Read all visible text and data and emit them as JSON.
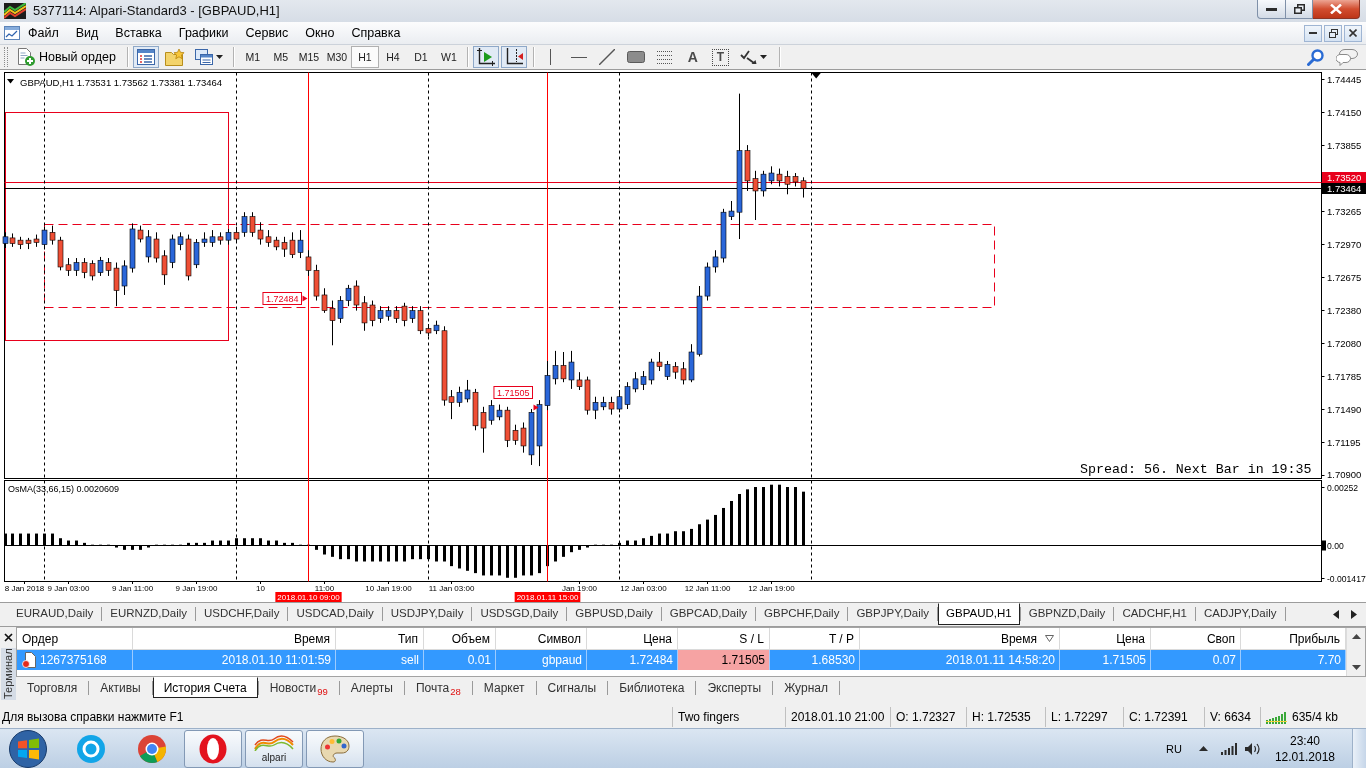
{
  "window": {
    "title": "5377114: Alpari-Standard3 - [GBPAUD,H1]"
  },
  "menu": [
    "Файл",
    "Вид",
    "Вставка",
    "Графики",
    "Сервис",
    "Окно",
    "Справка"
  ],
  "toolbar": {
    "new_order": "Новый ордер",
    "buttons": [
      {
        "kind": "market_watch",
        "pressed": true
      },
      {
        "kind": "navigator",
        "pressed": false
      },
      {
        "kind": "profiles",
        "pressed": false
      }
    ],
    "timeframes": [
      {
        "label": "M1",
        "selected": false
      },
      {
        "label": "M5",
        "selected": false
      },
      {
        "label": "M15",
        "selected": false
      },
      {
        "label": "M30",
        "selected": false
      },
      {
        "label": "H1",
        "selected": true
      },
      {
        "label": "H4",
        "selected": false
      },
      {
        "label": "D1",
        "selected": false
      },
      {
        "label": "W1",
        "selected": false
      }
    ],
    "chart_buttons": [
      {
        "kind": "autoscroll",
        "pressed": true
      },
      {
        "kind": "chart_shift",
        "pressed": true
      }
    ],
    "tools": [
      {
        "kind": "vertical_line"
      },
      {
        "kind": "horizontal_line"
      },
      {
        "kind": "trendline"
      },
      {
        "kind": "rectangle"
      },
      {
        "kind": "fibonacci"
      },
      {
        "kind": "text",
        "glyph": "A"
      },
      {
        "kind": "text_label",
        "glyph": "T"
      },
      {
        "kind": "arrows"
      }
    ]
  },
  "chart": {
    "chart_data": [
      {
        "type": "candlestick",
        "title": "GBPAUD,H1 1.73531 1.73562 1.73381 1.73464",
        "x": [
          "2018-01-08T19:00",
          "2018-01-08T20:00",
          "2018-01-08T21:00",
          "2018-01-08T22:00",
          "2018-01-08T23:00",
          "2018-01-09T00:00",
          "2018-01-09T01:00",
          "2018-01-09T02:00",
          "2018-01-09T03:00",
          "2018-01-09T04:00",
          "2018-01-09T05:00",
          "2018-01-09T06:00",
          "2018-01-09T07:00",
          "2018-01-09T08:00",
          "2018-01-09T09:00",
          "2018-01-09T10:00",
          "2018-01-09T11:00",
          "2018-01-09T12:00",
          "2018-01-09T13:00",
          "2018-01-09T14:00",
          "2018-01-09T15:00",
          "2018-01-09T16:00",
          "2018-01-09T17:00",
          "2018-01-09T18:00",
          "2018-01-09T19:00",
          "2018-01-09T20:00",
          "2018-01-09T21:00",
          "2018-01-09T22:00",
          "2018-01-09T23:00",
          "2018-01-10T00:00",
          "2018-01-10T01:00",
          "2018-01-10T02:00",
          "2018-01-10T03:00",
          "2018-01-10T04:00",
          "2018-01-10T05:00",
          "2018-01-10T06:00",
          "2018-01-10T07:00",
          "2018-01-10T08:00",
          "2018-01-10T09:00",
          "2018-01-10T10:00",
          "2018-01-10T11:00",
          "2018-01-10T12:00",
          "2018-01-10T13:00",
          "2018-01-10T14:00",
          "2018-01-10T15:00",
          "2018-01-10T16:00",
          "2018-01-10T17:00",
          "2018-01-10T18:00",
          "2018-01-10T19:00",
          "2018-01-10T20:00",
          "2018-01-10T21:00",
          "2018-01-10T22:00",
          "2018-01-10T23:00",
          "2018-01-11T00:00",
          "2018-01-11T01:00",
          "2018-01-11T02:00",
          "2018-01-11T03:00",
          "2018-01-11T04:00",
          "2018-01-11T05:00",
          "2018-01-11T06:00",
          "2018-01-11T07:00",
          "2018-01-11T08:00",
          "2018-01-11T09:00",
          "2018-01-11T10:00",
          "2018-01-11T11:00",
          "2018-01-11T12:00",
          "2018-01-11T13:00",
          "2018-01-11T14:00",
          "2018-01-11T15:00",
          "2018-01-11T16:00",
          "2018-01-11T17:00",
          "2018-01-11T18:00",
          "2018-01-11T19:00",
          "2018-01-11T20:00",
          "2018-01-11T21:00",
          "2018-01-11T22:00",
          "2018-01-11T23:00",
          "2018-01-12T00:00",
          "2018-01-12T01:00",
          "2018-01-12T02:00",
          "2018-01-12T03:00",
          "2018-01-12T04:00",
          "2018-01-12T05:00",
          "2018-01-12T06:00",
          "2018-01-12T07:00",
          "2018-01-12T08:00",
          "2018-01-12T09:00",
          "2018-01-12T10:00",
          "2018-01-12T11:00",
          "2018-01-12T12:00",
          "2018-01-12T13:00",
          "2018-01-12T14:00",
          "2018-01-12T15:00",
          "2018-01-12T16:00",
          "2018-01-12T17:00",
          "2018-01-12T18:00",
          "2018-01-12T19:00",
          "2018-01-12T20:00",
          "2018-01-12T21:00",
          "2018-01-12T22:00",
          "2018-01-12T23:00"
        ],
        "ohlc": [
          [
            1.7297,
            1.7307,
            1.7293,
            1.7303
          ],
          [
            1.7302,
            1.7306,
            1.7294,
            1.7297
          ],
          [
            1.73,
            1.7303,
            1.7292,
            1.7296
          ],
          [
            1.73,
            1.7302,
            1.7292,
            1.7297
          ],
          [
            1.7301,
            1.7305,
            1.7294,
            1.7298
          ],
          [
            1.7296,
            1.7312,
            1.7292,
            1.7309
          ],
          [
            1.7307,
            1.7313,
            1.7296,
            1.73
          ],
          [
            1.73,
            1.7303,
            1.7273,
            1.7276
          ],
          [
            1.7278,
            1.7284,
            1.7268,
            1.7273
          ],
          [
            1.7273,
            1.7284,
            1.7268,
            1.728
          ],
          [
            1.728,
            1.7284,
            1.7266,
            1.7271
          ],
          [
            1.7279,
            1.7282,
            1.7264,
            1.7268
          ],
          [
            1.7271,
            1.7285,
            1.7268,
            1.7282
          ],
          [
            1.728,
            1.7284,
            1.7268,
            1.7273
          ],
          [
            1.7275,
            1.728,
            1.7241,
            1.7255
          ],
          [
            1.7259,
            1.7282,
            1.7251,
            1.7277
          ],
          [
            1.7275,
            1.7315,
            1.7271,
            1.731
          ],
          [
            1.7309,
            1.7313,
            1.7298,
            1.7301
          ],
          [
            1.7285,
            1.7309,
            1.728,
            1.7303
          ],
          [
            1.7301,
            1.7307,
            1.728,
            1.7284
          ],
          [
            1.7286,
            1.7291,
            1.726,
            1.7269
          ],
          [
            1.728,
            1.7305,
            1.7275,
            1.7301
          ],
          [
            1.7296,
            1.7307,
            1.7291,
            1.7303
          ],
          [
            1.7301,
            1.7305,
            1.7264,
            1.7268
          ],
          [
            1.7278,
            1.7301,
            1.7275,
            1.7298
          ],
          [
            1.7298,
            1.7307,
            1.7294,
            1.7301
          ],
          [
            1.7298,
            1.7309,
            1.7294,
            1.7303
          ],
          [
            1.7303,
            1.7307,
            1.7296,
            1.73
          ],
          [
            1.73,
            1.731,
            1.7296,
            1.7307
          ],
          [
            1.7307,
            1.7312,
            1.7298,
            1.7301
          ],
          [
            1.7307,
            1.7325,
            1.7303,
            1.7321
          ],
          [
            1.7321,
            1.7325,
            1.7303,
            1.7307
          ],
          [
            1.7309,
            1.7316,
            1.7296,
            1.7301
          ],
          [
            1.7303,
            1.7309,
            1.7294,
            1.7298
          ],
          [
            1.73,
            1.7303,
            1.7291,
            1.7294
          ],
          [
            1.7298,
            1.7303,
            1.7285,
            1.7292
          ],
          [
            1.73,
            1.7307,
            1.7284,
            1.7287
          ],
          [
            1.7289,
            1.7309,
            1.7284,
            1.73
          ],
          [
            1.7285,
            1.7291,
            1.7268,
            1.7273
          ],
          [
            1.7273,
            1.7278,
            1.7246,
            1.725
          ],
          [
            1.7251,
            1.7257,
            1.7235,
            1.7237
          ],
          [
            1.7239,
            1.7246,
            1.7206,
            1.7228
          ],
          [
            1.723,
            1.725,
            1.7226,
            1.7246
          ],
          [
            1.7246,
            1.726,
            1.7241,
            1.7257
          ],
          [
            1.7259,
            1.7264,
            1.7237,
            1.7242
          ],
          [
            1.7244,
            1.725,
            1.7219,
            1.7226
          ],
          [
            1.7242,
            1.7246,
            1.7223,
            1.7228
          ],
          [
            1.723,
            1.7241,
            1.7226,
            1.7237
          ],
          [
            1.7232,
            1.7241,
            1.7228,
            1.7237
          ],
          [
            1.7237,
            1.7241,
            1.7226,
            1.723
          ],
          [
            1.7241,
            1.7244,
            1.7223,
            1.7228
          ],
          [
            1.723,
            1.7241,
            1.7226,
            1.7237
          ],
          [
            1.7237,
            1.7241,
            1.7216,
            1.7219
          ],
          [
            1.7221,
            1.7225,
            1.7214,
            1.7217
          ],
          [
            1.7219,
            1.7228,
            1.7216,
            1.7224
          ],
          [
            1.7219,
            1.7223,
            1.7152,
            1.7157
          ],
          [
            1.716,
            1.7166,
            1.714,
            1.7155
          ],
          [
            1.7155,
            1.7169,
            1.7151,
            1.7164
          ],
          [
            1.7158,
            1.7175,
            1.7155,
            1.7166
          ],
          [
            1.7164,
            1.7167,
            1.713,
            1.7134
          ],
          [
            1.7146,
            1.7151,
            1.711,
            1.7132
          ],
          [
            1.7139,
            1.7157,
            1.7135,
            1.7152
          ],
          [
            1.7142,
            1.7153,
            1.7139,
            1.7148
          ],
          [
            1.7148,
            1.7151,
            1.7115,
            1.7121
          ],
          [
            1.713,
            1.7135,
            1.7117,
            1.7121
          ],
          [
            1.7132,
            1.7137,
            1.711,
            1.7116
          ],
          [
            1.7108,
            1.7149,
            1.7099,
            1.7146
          ],
          [
            1.7116,
            1.7157,
            1.7098,
            1.7153
          ],
          [
            1.7152,
            1.7192,
            1.7148,
            1.7179
          ],
          [
            1.7176,
            1.7201,
            1.7171,
            1.7188
          ],
          [
            1.7188,
            1.72,
            1.7173,
            1.7176
          ],
          [
            1.7175,
            1.7201,
            1.7167,
            1.7191
          ],
          [
            1.7175,
            1.7182,
            1.7166,
            1.7169
          ],
          [
            1.7175,
            1.7178,
            1.7144,
            1.7148
          ],
          [
            1.7148,
            1.716,
            1.714,
            1.7155
          ],
          [
            1.7151,
            1.716,
            1.7148,
            1.7155
          ],
          [
            1.7155,
            1.716,
            1.7144,
            1.7149
          ],
          [
            1.7149,
            1.7166,
            1.7146,
            1.716
          ],
          [
            1.7153,
            1.7173,
            1.7149,
            1.7169
          ],
          [
            1.7167,
            1.7182,
            1.7164,
            1.7176
          ],
          [
            1.7171,
            1.7183,
            1.7166,
            1.7178
          ],
          [
            1.7175,
            1.7194,
            1.7171,
            1.7191
          ],
          [
            1.7191,
            1.72,
            1.7183,
            1.7187
          ],
          [
            1.7178,
            1.7192,
            1.7175,
            1.7189
          ],
          [
            1.7187,
            1.7191,
            1.7176,
            1.7182
          ],
          [
            1.7185,
            1.7191,
            1.7171,
            1.7175
          ],
          [
            1.7175,
            1.7207,
            1.7173,
            1.72
          ],
          [
            1.7198,
            1.7259,
            1.7196,
            1.725
          ],
          [
            1.725,
            1.728,
            1.7246,
            1.7276
          ],
          [
            1.7276,
            1.7291,
            1.7271,
            1.7285
          ],
          [
            1.7284,
            1.7328,
            1.728,
            1.7325
          ],
          [
            1.7321,
            1.7335,
            1.7318,
            1.7326
          ],
          [
            1.7325,
            1.7431,
            1.7301,
            1.738
          ],
          [
            1.738,
            1.7385,
            1.7344,
            1.7353
          ],
          [
            1.7355,
            1.7362,
            1.7318,
            1.7344
          ],
          [
            1.7344,
            1.7362,
            1.7339,
            1.7359
          ],
          [
            1.7353,
            1.7366,
            1.735,
            1.736
          ],
          [
            1.7359,
            1.7364,
            1.7348,
            1.7353
          ],
          [
            1.7357,
            1.7362,
            1.7341,
            1.735
          ],
          [
            1.7357,
            1.736,
            1.7348,
            1.7352
          ],
          [
            1.73531,
            1.73562,
            1.73381,
            1.73464
          ]
        ],
        "series": [
          {
            "type": "scatter",
            "x": [
              "2018-01-10T09:00",
              "2018-01-11T14:00"
            ],
            "values": [
              1.72484,
              1.71505
            ],
            "color": "#e8001c",
            "data_labels": true
          }
        ],
        "xlim": [
          "2018-01-08T19:00",
          "2018-01-15T16:00"
        ],
        "ylim": [
          1.70869,
          1.74499
        ],
        "yticks": [
          {
            "value": 1.74445,
            "label": "1.74445"
          },
          {
            "value": 1.7415,
            "label": "1.74150"
          },
          {
            "value": 1.73855,
            "label": "1.73855"
          },
          {
            "value": 1.73265,
            "label": "1.73265"
          },
          {
            "value": 1.7297,
            "label": "1.72970"
          },
          {
            "value": 1.72675,
            "label": "1.72675"
          },
          {
            "value": 1.7238,
            "label": "1.72380"
          },
          {
            "value": 1.7208,
            "label": "1.72080"
          },
          {
            "value": 1.71785,
            "label": "1.71785"
          },
          {
            "value": 1.7149,
            "label": "1.71490"
          },
          {
            "value": 1.71195,
            "label": "1.71195"
          },
          {
            "value": 1.709,
            "label": "1.70900"
          }
        ],
        "tick_labels": "y",
        "ref_lines": [
          {
            "axis": "y",
            "value": 1.7352,
            "label": "1.73520",
            "color": "#e8001c"
          },
          {
            "axis": "y",
            "value": 1.73464,
            "label": "1.73464",
            "color": "#000000"
          },
          {
            "axis": "x",
            "value": "2018-01-10T09:00",
            "label": "2018.01.10 09:00",
            "color": "#ff0000"
          },
          {
            "axis": "x",
            "value": "2018-01-11T15:00",
            "label": "2018.01.11 15:00",
            "color": "#ff0000"
          },
          {
            "axis": "x",
            "value": "2018-01-09T00:00",
            "color": "#000000",
            "line_style": "dashed"
          },
          {
            "axis": "x",
            "value": "2018-01-10T00:00",
            "color": "#000000",
            "line_style": "dashed"
          },
          {
            "axis": "x",
            "value": "2018-01-11T00:00",
            "color": "#000000",
            "line_style": "dashed"
          },
          {
            "axis": "x",
            "value": "2018-01-12T00:00",
            "color": "#000000",
            "line_style": "dashed"
          },
          {
            "axis": "x",
            "value": "2018-01-13T00:00",
            "color": "#000000",
            "line_style": "dashed"
          }
        ],
        "annotations": [
          "Spread: 56. Next Bar in 19:35"
        ]
      },
      {
        "type": "bar",
        "title": "OsMA(33,66,15) 0.0020609",
        "x": [
          "2018-01-08T19:00",
          "2018-01-08T20:00",
          "2018-01-08T21:00",
          "2018-01-08T22:00",
          "2018-01-08T23:00",
          "2018-01-09T00:00",
          "2018-01-09T01:00",
          "2018-01-09T02:00",
          "2018-01-09T03:00",
          "2018-01-09T04:00",
          "2018-01-09T05:00",
          "2018-01-09T06:00",
          "2018-01-09T07:00",
          "2018-01-09T08:00",
          "2018-01-09T09:00",
          "2018-01-09T10:00",
          "2018-01-09T11:00",
          "2018-01-09T12:00",
          "2018-01-09T13:00",
          "2018-01-09T14:00",
          "2018-01-09T15:00",
          "2018-01-09T16:00",
          "2018-01-09T17:00",
          "2018-01-09T18:00",
          "2018-01-09T19:00",
          "2018-01-09T20:00",
          "2018-01-09T21:00",
          "2018-01-09T22:00",
          "2018-01-09T23:00",
          "2018-01-10T00:00",
          "2018-01-10T01:00",
          "2018-01-10T02:00",
          "2018-01-10T03:00",
          "2018-01-10T04:00",
          "2018-01-10T05:00",
          "2018-01-10T06:00",
          "2018-01-10T07:00",
          "2018-01-10T08:00",
          "2018-01-10T09:00",
          "2018-01-10T10:00",
          "2018-01-10T11:00",
          "2018-01-10T12:00",
          "2018-01-10T13:00",
          "2018-01-10T14:00",
          "2018-01-10T15:00",
          "2018-01-10T16:00",
          "2018-01-10T17:00",
          "2018-01-10T18:00",
          "2018-01-10T19:00",
          "2018-01-10T20:00",
          "2018-01-10T21:00",
          "2018-01-10T22:00",
          "2018-01-10T23:00",
          "2018-01-11T00:00",
          "2018-01-11T01:00",
          "2018-01-11T02:00",
          "2018-01-11T03:00",
          "2018-01-11T04:00",
          "2018-01-11T05:00",
          "2018-01-11T06:00",
          "2018-01-11T07:00",
          "2018-01-11T08:00",
          "2018-01-11T09:00",
          "2018-01-11T10:00",
          "2018-01-11T11:00",
          "2018-01-11T12:00",
          "2018-01-11T13:00",
          "2018-01-11T14:00",
          "2018-01-11T15:00",
          "2018-01-11T16:00",
          "2018-01-11T17:00",
          "2018-01-11T18:00",
          "2018-01-11T19:00",
          "2018-01-11T20:00",
          "2018-01-11T21:00",
          "2018-01-11T22:00",
          "2018-01-11T23:00",
          "2018-01-12T00:00",
          "2018-01-12T01:00",
          "2018-01-12T02:00",
          "2018-01-12T03:00",
          "2018-01-12T04:00",
          "2018-01-12T05:00",
          "2018-01-12T06:00",
          "2018-01-12T07:00",
          "2018-01-12T08:00",
          "2018-01-12T09:00",
          "2018-01-12T10:00",
          "2018-01-12T11:00",
          "2018-01-12T12:00",
          "2018-01-12T13:00",
          "2018-01-12T14:00",
          "2018-01-12T15:00",
          "2018-01-12T16:00",
          "2018-01-12T17:00",
          "2018-01-12T18:00",
          "2018-01-12T19:00",
          "2018-01-12T20:00",
          "2018-01-12T21:00",
          "2018-01-12T22:00",
          "2018-01-12T23:00"
        ],
        "values": [
          0.0005,
          0.0005,
          0.0005,
          0.0005,
          0.0005,
          0.0005,
          0.0005,
          0.0003,
          0.0002,
          0.0002,
          0.0001,
          0,
          0,
          0,
          -0.0001,
          -0.0002,
          -0.0002,
          -0.0002,
          -0.0001,
          0,
          0,
          0,
          0,
          0.0001,
          0.0001,
          0.0001,
          0.0002,
          0.0002,
          0.0002,
          0.0003,
          0.0003,
          0.0003,
          0.0003,
          0.0002,
          0.0002,
          0.0001,
          0.0001,
          0,
          0,
          -0.0002,
          -0.0004,
          -0.0005,
          -0.0006,
          -0.0006,
          -0.0007,
          -0.0007,
          -0.0007,
          -0.0007,
          -0.0007,
          -0.0007,
          -0.0007,
          -0.0006,
          -0.0006,
          -0.0006,
          -0.0007,
          -0.0007,
          -0.0009,
          -0.001,
          -0.0011,
          -0.0012,
          -0.0013,
          -0.0013,
          -0.0013,
          -0.0014,
          -0.0014,
          -0.0013,
          -0.0013,
          -0.0012,
          -0.0009,
          -0.0007,
          -0.0005,
          -0.0003,
          -0.0002,
          -0.0001,
          0,
          0,
          0,
          0.0001,
          0.0002,
          0.0002,
          0.0003,
          0.0004,
          0.0005,
          0.0005,
          0.0006,
          0.0006,
          0.0007,
          0.0009,
          0.0011,
          0.0013,
          0.0016,
          0.0019,
          0.0022,
          0.0024,
          0.0025,
          0.0025,
          0.0026,
          0.0026,
          0.0025,
          0.0025,
          0.0023
        ],
        "color": "#000000",
        "xlim": [
          "2018-01-08T19:00",
          "2018-01-15T16:00"
        ],
        "ylim": [
          -0.00156,
          0.00278
        ],
        "yticks": [
          {
            "value": 0.00252,
            "label": "0.00252"
          },
          {
            "value": 0,
            "label": "0.00"
          },
          {
            "value": -0.001417,
            "label": "-0.001417"
          }
        ],
        "xticks": [
          {
            "value": "2018-01-08T21:30",
            "label": "8 Jan 2018"
          },
          {
            "value": "2018-01-09T03:00",
            "label": "9 Jan 03:00"
          },
          {
            "value": "2018-01-09T11:00",
            "label": "9 Jan 11:00"
          },
          {
            "value": "2018-01-09T19:00",
            "label": "9 Jan 19:00"
          },
          {
            "value": "2018-01-10T03:00",
            "label": "10"
          },
          {
            "value": "2018-01-10T11:00",
            "label": "11:00"
          },
          {
            "value": "2018-01-10T19:00",
            "label": "10 Jan 19:00"
          },
          {
            "value": "2018-01-11T03:00",
            "label": "11 Jan 03:00"
          },
          {
            "value": "2018-01-11T19:00",
            "label": "Jan 19:00"
          },
          {
            "value": "2018-01-12T03:00",
            "label": "12 Jan 03:00"
          },
          {
            "value": "2018-01-12T11:00",
            "label": "12 Jan 11:00"
          },
          {
            "value": "2018-01-12T19:00",
            "label": "12 Jan 19:00"
          }
        ],
        "ref_lines": [
          {
            "axis": "y",
            "value": 0,
            "color": "#000000"
          }
        ]
      }
    ]
  },
  "chart_tabs": [
    {
      "label": "EURAUD,Daily",
      "selected": false
    },
    {
      "label": "EURNZD,Daily",
      "selected": false
    },
    {
      "label": "USDCHF,Daily",
      "selected": false
    },
    {
      "label": "USDCAD,Daily",
      "selected": false
    },
    {
      "label": "USDJPY,Daily",
      "selected": false
    },
    {
      "label": "USDSGD,Daily",
      "selected": false
    },
    {
      "label": "GBPUSD,Daily",
      "selected": false
    },
    {
      "label": "GBPCAD,Daily",
      "selected": false
    },
    {
      "label": "GBPCHF,Daily",
      "selected": false
    },
    {
      "label": "GBPJPY,Daily",
      "selected": false
    },
    {
      "label": "GBPAUD,H1",
      "selected": true
    },
    {
      "label": "GBPNZD,Daily",
      "selected": false
    },
    {
      "label": "CADCHF,H1",
      "selected": false
    },
    {
      "label": "CADJPY,Daily",
      "selected": false
    }
  ],
  "terminal": {
    "title": "Терминал",
    "columns": [
      {
        "label": "Ордер",
        "sorted": false
      },
      {
        "label": "Время",
        "sorted": false
      },
      {
        "label": "Тип",
        "sorted": false
      },
      {
        "label": "Объем",
        "sorted": false
      },
      {
        "label": "Символ",
        "sorted": false
      },
      {
        "label": "Цена",
        "sorted": false
      },
      {
        "label": "S / L",
        "sorted": false
      },
      {
        "label": "T / P",
        "sorted": false
      },
      {
        "label": "Время",
        "sorted": true
      },
      {
        "label": "Цена",
        "sorted": false
      },
      {
        "label": "Своп",
        "sorted": false
      },
      {
        "label": "Прибыль",
        "sorted": false
      }
    ],
    "rows": [
      {
        "selected": true,
        "order": "1267375168",
        "open_time": "2018.01.10 11:01:59",
        "type": "sell",
        "volume": "0.01",
        "symbol": "gbpaud",
        "open_price": "1.72484",
        "sl": "1.71505",
        "tp": "1.68530",
        "close_time": "2018.01.11 14:58:20",
        "close_price": "1.71505",
        "swap": "0.07",
        "profit": "7.70",
        "sl_hit": true
      }
    ],
    "tabs": [
      {
        "label": "Торговля",
        "selected": false
      },
      {
        "label": "Активы",
        "selected": false
      },
      {
        "label": "История Счета",
        "selected": true
      },
      {
        "label": "Новости",
        "selected": false,
        "badge": "99"
      },
      {
        "label": "Алерты",
        "selected": false
      },
      {
        "label": "Почта",
        "selected": false,
        "badge": "28"
      },
      {
        "label": "Маркет",
        "selected": false
      },
      {
        "label": "Сигналы",
        "selected": false
      },
      {
        "label": "Библиотека",
        "selected": false
      },
      {
        "label": "Эксперты",
        "selected": false
      },
      {
        "label": "Журнал",
        "selected": false
      }
    ]
  },
  "status_bar": {
    "hint": "Для вызова справки нажмите F1",
    "profile": "Two fingers",
    "bar_time": "2018.01.10 21:00",
    "open": "O: 1.72327",
    "high": "H: 1.72535",
    "low": "L: 1.72297",
    "close": "C: 1.72391",
    "volume": "V: 6634",
    "traffic": "635/4 kb"
  },
  "taskbar": {
    "apps": [
      {
        "kind": "skype",
        "open": false
      },
      {
        "kind": "chrome",
        "open": false
      },
      {
        "kind": "opera",
        "open": true
      },
      {
        "kind": "alpari",
        "open": true,
        "label": "alpari"
      },
      {
        "kind": "paint",
        "open": true
      }
    ],
    "language": "RU",
    "time": "23:40",
    "date": "12.01.2018"
  }
}
